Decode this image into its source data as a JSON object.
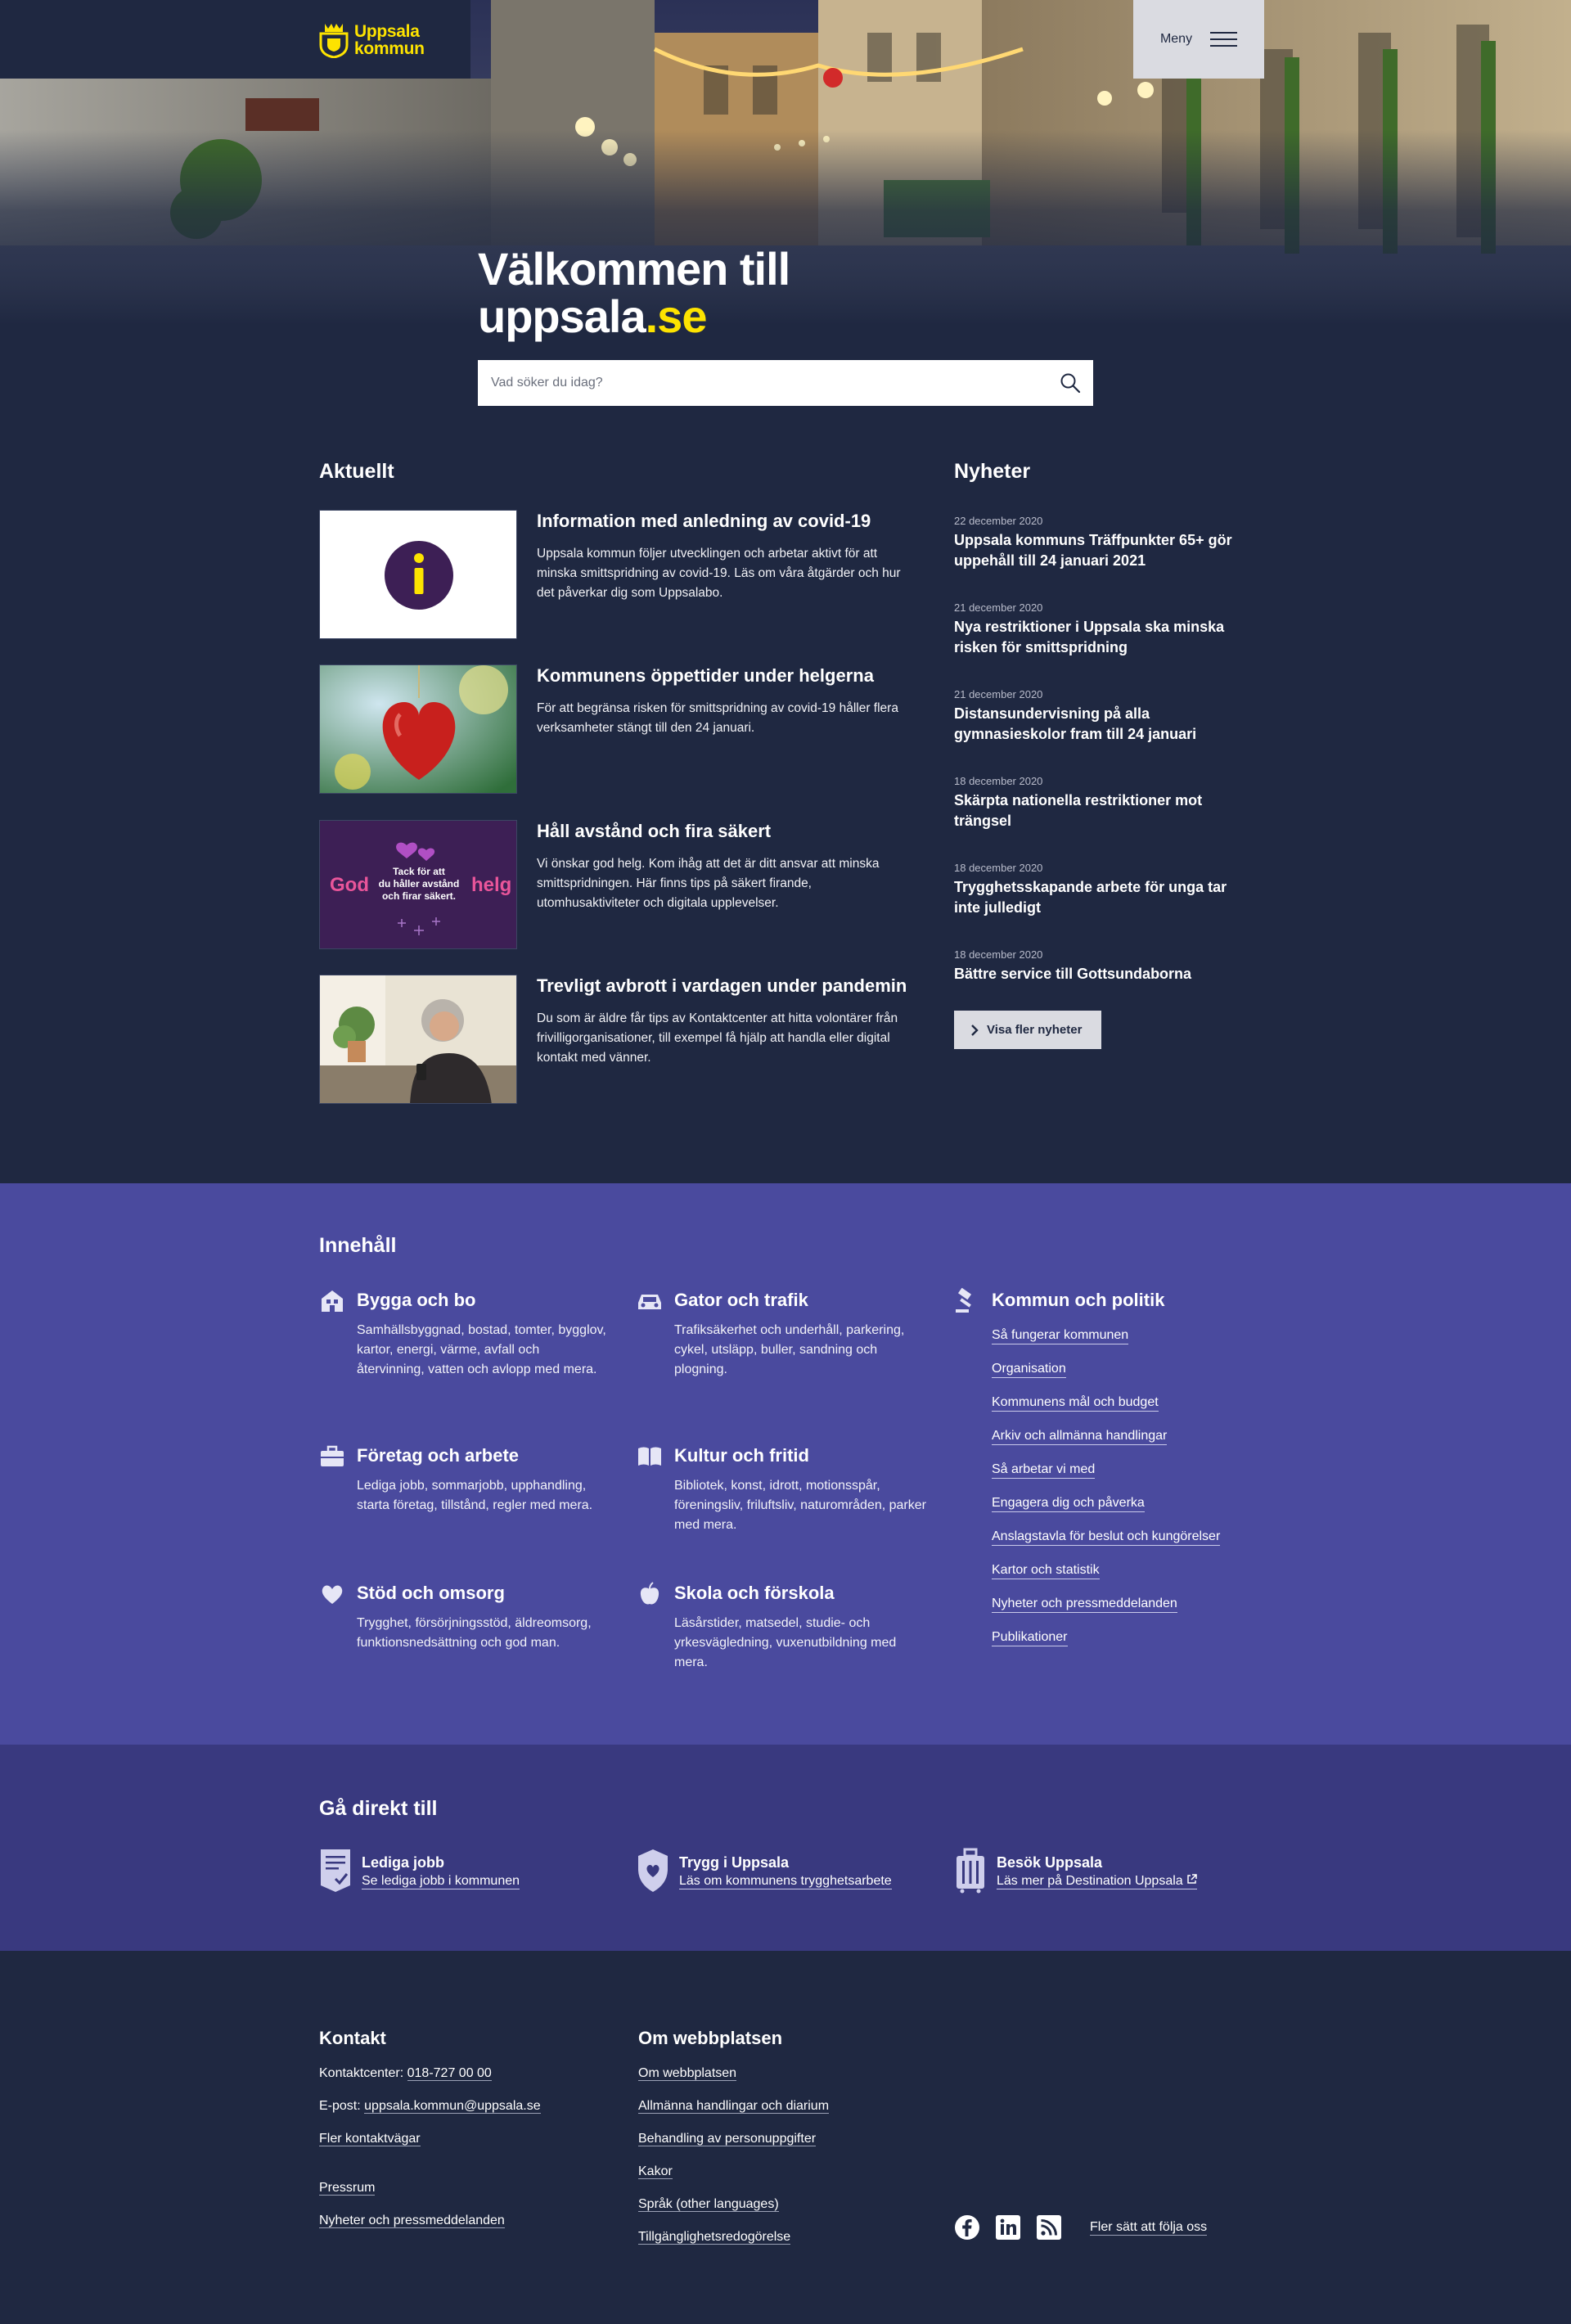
{
  "header": {
    "logo_line1": "Uppsala",
    "logo_line2": "kommun",
    "menu_label": "Meny"
  },
  "hero": {
    "title_line1": "Välkommen till",
    "title_domain": "uppsala",
    "title_tld": ".se",
    "search_placeholder": "Vad söker du idag?"
  },
  "aktuellt": {
    "heading": "Aktuellt",
    "items": [
      {
        "title": "Information med anledning av covid-19",
        "text": "Uppsala kommun följer utvecklingen och arbetar aktivt för att minska smittspridning av covid-19. Läs om våra åtgärder och hur det påverkar dig som Uppsalabo."
      },
      {
        "title": "Kommunens öppettider under helgerna",
        "text": "För att begränsa risken för smittspridning av covid-19 håller flera verksamheter stängt till den 24 januari."
      },
      {
        "title": "Håll avstånd och fira säkert",
        "text": "Vi önskar god helg. Kom ihåg att det är ditt ansvar att minska smittspridningen. Här finns tips på säkert firande, utomhusaktiviteter och digitala upplevelser."
      },
      {
        "title": "Trevligt avbrott i vardagen under pandemin",
        "text": "Du som är äldre får tips av Kontaktcenter att hitta volontärer från frivilligorganisationer, till exempel få hjälp att handla eller digital kontakt med vänner."
      }
    ],
    "promo_image": {
      "left": "God",
      "lines": [
        "Tack för att",
        "du håller avstånd",
        "och firar säkert."
      ],
      "right": "helg"
    }
  },
  "nyheter": {
    "heading": "Nyheter",
    "items": [
      {
        "date": "22 december 2020",
        "title": "Uppsala kommuns Träffpunkter 65+ gör uppehåll till 24 januari 2021"
      },
      {
        "date": "21 december 2020",
        "title": "Nya restriktioner i Uppsala ska minska risken för smittspridning"
      },
      {
        "date": "21 december 2020",
        "title": "Distansundervisning på alla gymnasieskolor fram till 24 januari"
      },
      {
        "date": "18 december 2020",
        "title": "Skärpta nationella restriktioner mot trängsel"
      },
      {
        "date": "18 december 2020",
        "title": "Trygghetsskapande arbete för unga tar inte julledigt"
      },
      {
        "date": "18 december 2020",
        "title": "Bättre service till Gottsundaborna"
      }
    ],
    "more_label": "Visa fler nyheter"
  },
  "innehall": {
    "heading": "Innehåll",
    "categories": [
      {
        "icon": "house-icon",
        "name": "Bygga och bo",
        "desc": "Samhällsbyggnad, bostad, tomter, bygglov, kartor, energi, värme, avfall och återvinning, vatten och avlopp med mera."
      },
      {
        "icon": "car-icon",
        "name": "Gator och trafik",
        "desc": "Trafiksäkerhet och underhåll, parkering, cykel, utsläpp, buller, sandning och plogning."
      },
      {
        "icon": "briefcase-icon",
        "name": "Företag och arbete",
        "desc": "Lediga jobb, sommarjobb, upphandling, starta företag, tillstånd, regler med mera."
      },
      {
        "icon": "book-icon",
        "name": "Kultur och fritid",
        "desc": "Bibliotek, konst, idrott, motionsspår, föreningsliv, friluftsliv, naturområden, parker med mera."
      },
      {
        "icon": "heart-icon",
        "name": "Stöd och omsorg",
        "desc": "Trygghet, försörjningsstöd, äldreomsorg, funktionsnedsättning och god man."
      },
      {
        "icon": "apple-icon",
        "name": "Skola och förskola",
        "desc": "Läsårstider, matsedel, studie- och yrkesvägledning, vuxenutbildning med mera."
      }
    ],
    "politik": {
      "icon": "gavel-icon",
      "name": "Kommun och politik",
      "links": [
        "Så fungerar kommunen",
        "Organisation",
        "Kommunens mål och budget",
        "Arkiv och allmänna handlingar",
        "Så arbetar vi med",
        "Engagera dig och påverka",
        "Anslagstavla för beslut och kungörelser",
        "Kartor och statistik",
        "Nyheter och pressmeddelanden",
        "Publikationer"
      ]
    }
  },
  "ga_direkt": {
    "heading": "Gå direkt till",
    "items": [
      {
        "icon": "document-check-icon",
        "title": "Lediga jobb",
        "link": "Se lediga jobb i kommunen"
      },
      {
        "icon": "shield-heart-icon",
        "title": "Trygg i Uppsala",
        "link": "Läs om kommunens trygghetsarbete"
      },
      {
        "icon": "suitcase-icon",
        "title": "Besök Uppsala",
        "link": "Läs mer på Destination Uppsala"
      }
    ]
  },
  "footer": {
    "kontakt_heading": "Kontakt",
    "kontaktcenter_label": "Kontaktcenter:",
    "kontaktcenter_phone": "018-727 00 00",
    "epost_label": "E-post:",
    "epost": "uppsala.kommun@uppsala.se",
    "fler_kontakt": "Fler kontaktvägar",
    "pressrum": "Pressrum",
    "nyheter_press": "Nyheter och pressmeddelanden",
    "om_heading": "Om webbplatsen",
    "om_links": [
      "Om webbplatsen",
      "Allmänna handlingar och diarium",
      "Behandling av personuppgifter",
      "Kakor",
      "Språk (other languages)",
      "Tillgänglighetsredogörelse"
    ],
    "follow_label": "Fler sätt att följa oss"
  },
  "colors": {
    "navy": "#1f2841",
    "purple": "#4a4a9e",
    "dark_purple": "#39397f",
    "yellow": "#fde300"
  }
}
